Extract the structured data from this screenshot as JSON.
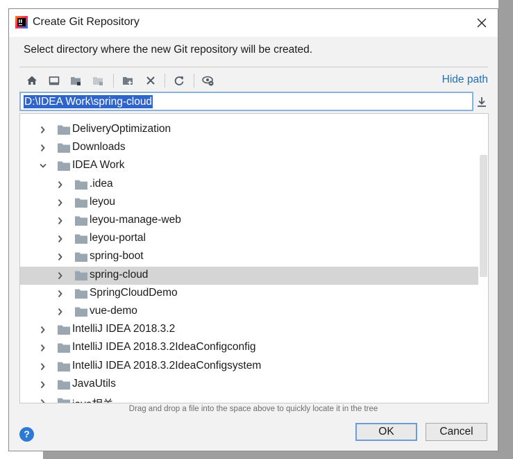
{
  "window": {
    "title": "Create Git Repository",
    "subtitle": "Select directory where the new Git repository will be created."
  },
  "toolbar": {
    "buttons": [
      "home-icon",
      "desktop-icon",
      "project-folder-icon",
      "module-folder-icon",
      "new-folder-icon",
      "delete-icon",
      "refresh-icon",
      "show-hidden-icon"
    ],
    "hide_path_label": "Hide path"
  },
  "path_field": {
    "value": "D:\\IDEA Work\\spring-cloud"
  },
  "tree": {
    "items": [
      {
        "label": "DeliveryOptimization",
        "depth": 1,
        "expanded": false,
        "selected": false
      },
      {
        "label": "Downloads",
        "depth": 1,
        "expanded": false,
        "selected": false
      },
      {
        "label": "IDEA Work",
        "depth": 1,
        "expanded": true,
        "selected": false
      },
      {
        "label": ".idea",
        "depth": 2,
        "expanded": false,
        "selected": false
      },
      {
        "label": "leyou",
        "depth": 2,
        "expanded": false,
        "selected": false
      },
      {
        "label": "leyou-manage-web",
        "depth": 2,
        "expanded": false,
        "selected": false
      },
      {
        "label": "leyou-portal",
        "depth": 2,
        "expanded": false,
        "selected": false
      },
      {
        "label": "spring-boot",
        "depth": 2,
        "expanded": false,
        "selected": false
      },
      {
        "label": "spring-cloud",
        "depth": 2,
        "expanded": false,
        "selected": true
      },
      {
        "label": "SpringCloudDemo",
        "depth": 2,
        "expanded": false,
        "selected": false
      },
      {
        "label": "vue-demo",
        "depth": 2,
        "expanded": false,
        "selected": false
      },
      {
        "label": "IntelliJ IDEA 2018.3.2",
        "depth": 1,
        "expanded": false,
        "selected": false
      },
      {
        "label": "IntelliJ IDEA 2018.3.2IdeaConfigconfig",
        "depth": 1,
        "expanded": false,
        "selected": false
      },
      {
        "label": "IntelliJ IDEA 2018.3.2IdeaConfigsystem",
        "depth": 1,
        "expanded": false,
        "selected": false
      },
      {
        "label": "JavaUtils",
        "depth": 1,
        "expanded": false,
        "selected": false
      },
      {
        "label": "java相关",
        "depth": 1,
        "expanded": false,
        "selected": false
      }
    ]
  },
  "hint": "Drag and drop a file into the space above to quickly locate it in the tree",
  "buttons": {
    "help": "?",
    "ok": "OK",
    "cancel": "Cancel"
  },
  "colors": {
    "accent": "#2470b3",
    "selection": "#2f65ca",
    "row_selected": "#d5d5d5",
    "folder": "#9aa7b0"
  }
}
